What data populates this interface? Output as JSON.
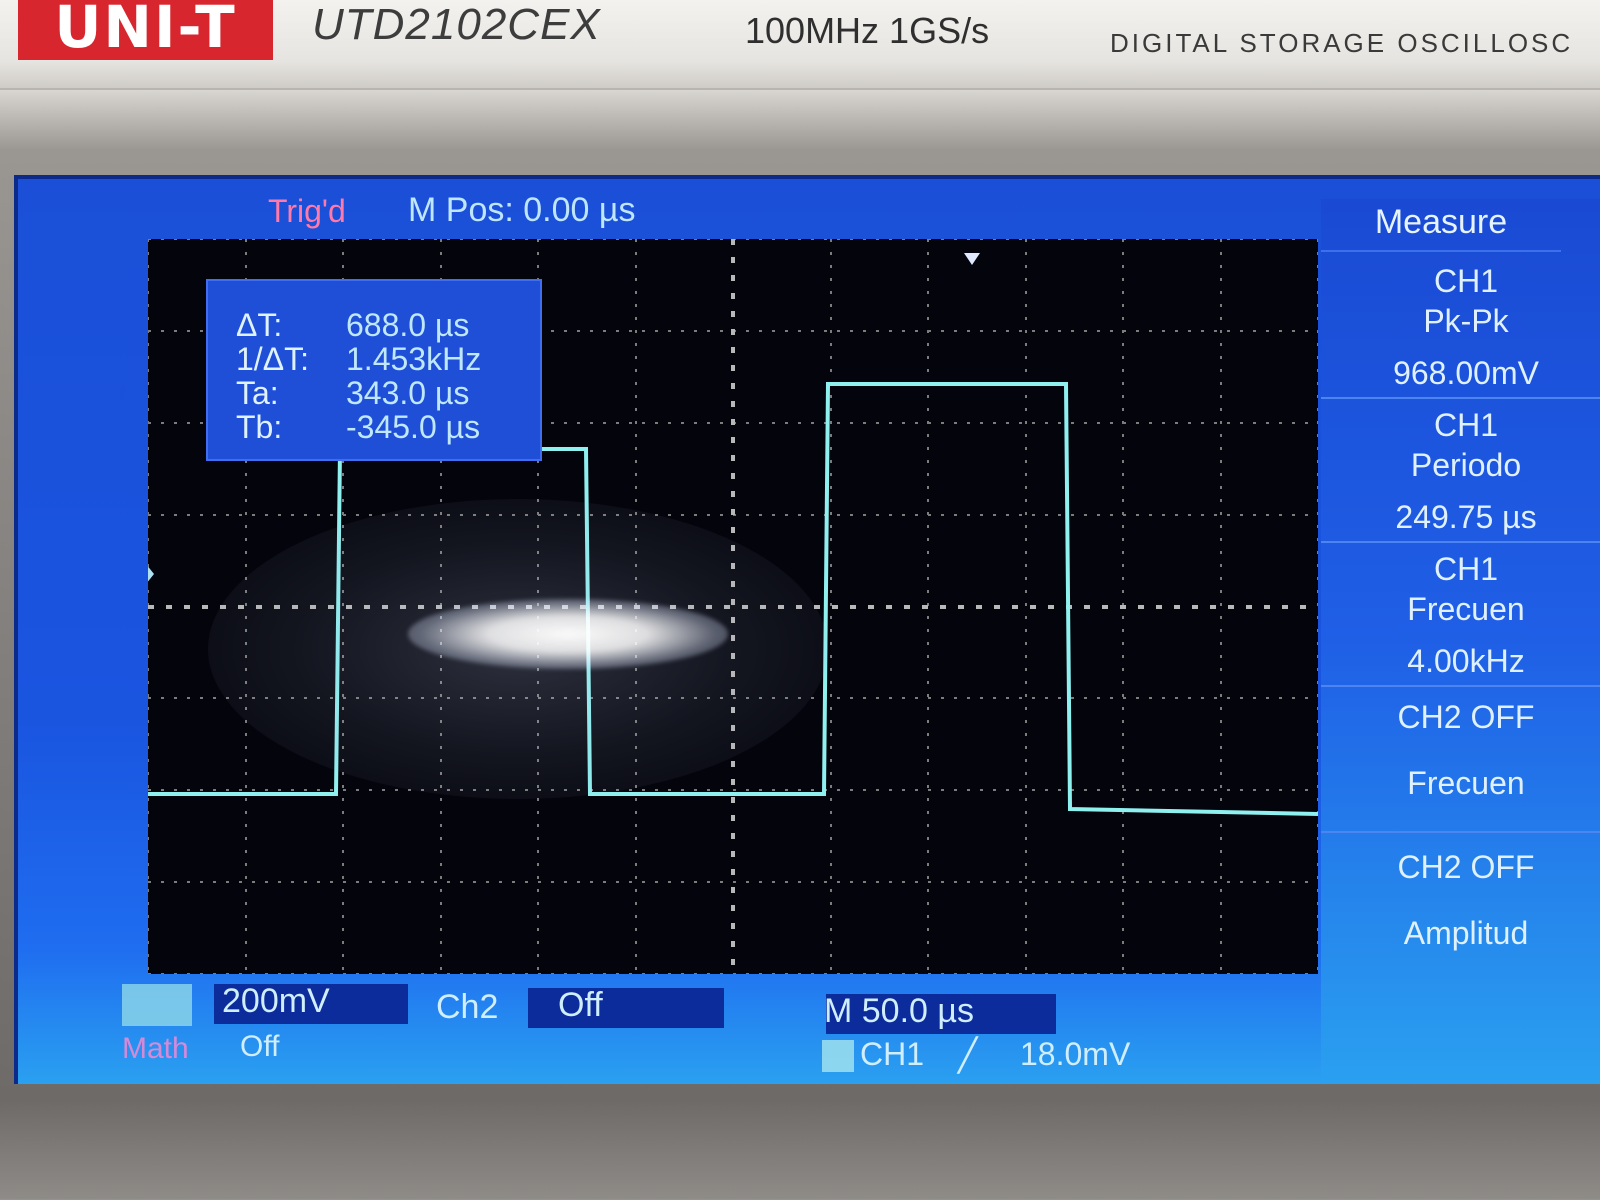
{
  "device": {
    "brand": "UNI-T",
    "model": "UTD2102CEX",
    "spec": "100MHz  1GS/s",
    "type": "DIGITAL STORAGE OSCILLOSC"
  },
  "status": {
    "trigger": "Trig'd",
    "mpos": "M Pos: 0.00 µs"
  },
  "cursor": [
    {
      "label": "ΔT:",
      "value": "688.0 µs"
    },
    {
      "label": "1/ΔT:",
      "value": "1.453kHz"
    },
    {
      "label": "Ta:",
      "value": "343.0 µs"
    },
    {
      "label": "Tb:",
      "value": "-345.0 µs"
    }
  ],
  "measure": {
    "title": "Measure",
    "items": [
      {
        "source": "CH1",
        "name": "Pk-Pk",
        "value": "968.00mV"
      },
      {
        "source": "CH1",
        "name": "Periodo",
        "value": "249.75 µs"
      },
      {
        "source": "CH1",
        "name": "Frecuen",
        "value": "4.00kHz"
      },
      {
        "source": "CH2 OFF",
        "name": "Frecuen",
        "value": ""
      },
      {
        "source": "CH2 OFF",
        "name": "Amplitud",
        "value": ""
      }
    ]
  },
  "bottom": {
    "ch1_scale": "200mV",
    "ch2_label": "Ch2",
    "ch2_state": "Off",
    "math_label": "Math",
    "math_state": "Off",
    "timebase": "M 50.0 µs",
    "trigger_source": "CH1",
    "trigger_symbol": "╱",
    "trigger_level": "18.0mV"
  },
  "colors": {
    "screen_blue": "#1b4fd8",
    "trace": "#8ff0f0",
    "trig_text": "#ff7aa8",
    "graticule": "#8a8a8a"
  },
  "trace": {
    "channel": "CH1",
    "waveform": "square",
    "pk_pk": "968.00mV",
    "frequency": "4.00kHz"
  }
}
